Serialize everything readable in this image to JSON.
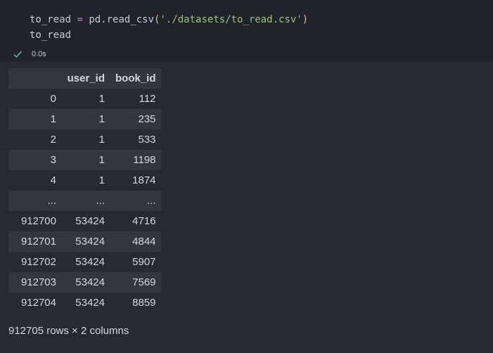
{
  "code": {
    "line1": {
      "var": "to_read",
      "op": " = ",
      "fn": "pd.read_csv",
      "open_paren": "(",
      "string": "'./datasets/to_read.csv'",
      "close_paren": ")"
    },
    "line2": "to_read"
  },
  "status": {
    "icon": "check-icon",
    "exec_time": "0.0s",
    "color": "#4ec9b0"
  },
  "table": {
    "columns": [
      "",
      "user_id",
      "book_id"
    ],
    "rows": [
      [
        "0",
        "1",
        "112"
      ],
      [
        "1",
        "1",
        "235"
      ],
      [
        "2",
        "1",
        "533"
      ],
      [
        "3",
        "1",
        "1198"
      ],
      [
        "4",
        "1",
        "1874"
      ],
      [
        "...",
        "...",
        "..."
      ],
      [
        "912700",
        "53424",
        "4716"
      ],
      [
        "912701",
        "53424",
        "4844"
      ],
      [
        "912702",
        "53424",
        "5907"
      ],
      [
        "912703",
        "53424",
        "7569"
      ],
      [
        "912704",
        "53424",
        "8859"
      ]
    ]
  },
  "shape": "912705 rows × 2 columns"
}
